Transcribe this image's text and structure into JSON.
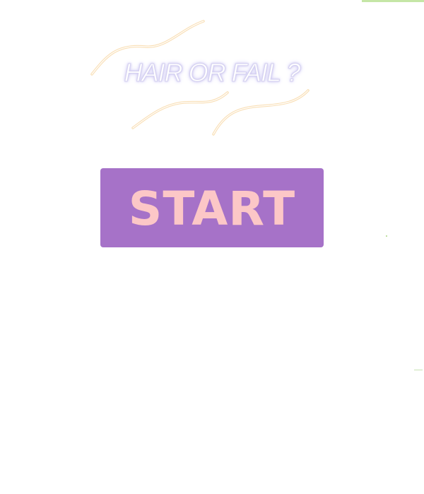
{
  "game": {
    "title": "HAIR OR FAIL ?",
    "start_label": "START"
  },
  "colors": {
    "background": "#ffffff",
    "start_button": "#a672c8",
    "start_text": "#fcc7c7",
    "hair_strand": "#f4c47a",
    "title_glow": "#c9c3f2"
  }
}
